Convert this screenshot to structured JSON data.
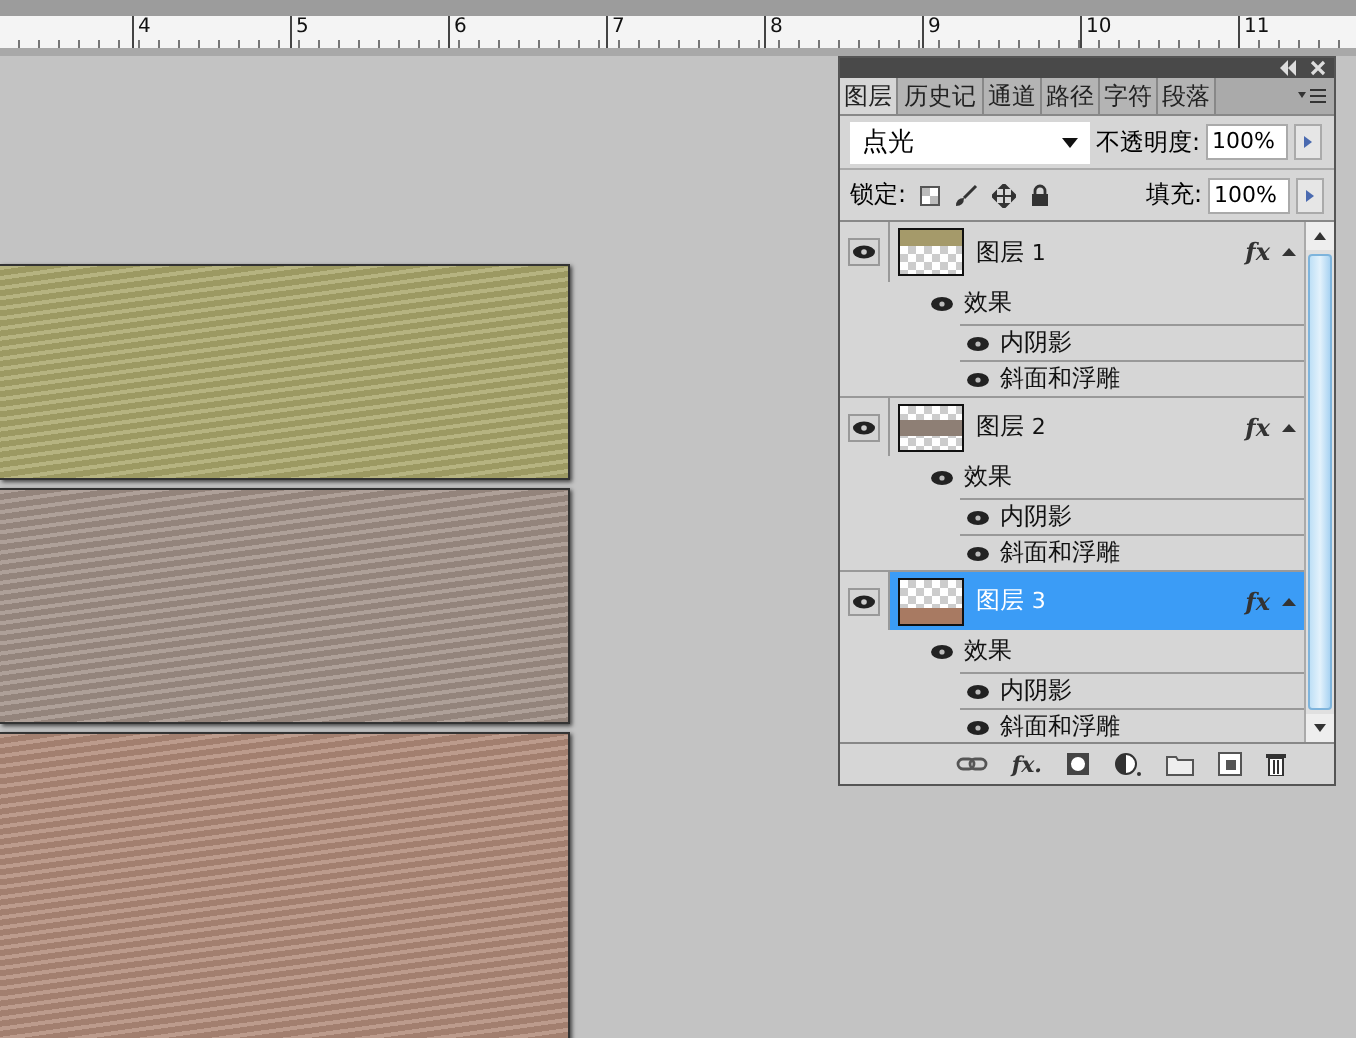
{
  "ruler": {
    "labels": [
      "4",
      "5",
      "6",
      "7",
      "8",
      "9",
      "10",
      "11"
    ]
  },
  "planks": [
    {
      "color": "#a9a66a"
    },
    {
      "color": "#a08f86"
    },
    {
      "color": "#b08a78"
    }
  ],
  "panel": {
    "tabs": [
      {
        "label": "图层",
        "selected": true
      },
      {
        "label": "历史记",
        "selected": false
      },
      {
        "label": "通道",
        "selected": false
      },
      {
        "label": "路径",
        "selected": false
      },
      {
        "label": "字符",
        "selected": false
      },
      {
        "label": "段落",
        "selected": false
      }
    ],
    "add_style_label": "fx.",
    "blend_mode": "点光",
    "opacity_label": "不透明度:",
    "opacity": "100%",
    "lock_label": "锁定:",
    "fill_label": "填充:",
    "fill": "100%",
    "layers": [
      {
        "name": "图层",
        "number": "1",
        "selected": false,
        "visible": true,
        "kind": "top",
        "fx_label": "fx",
        "color": "#a59a6a",
        "effects_label": "效果",
        "effects": [
          "内阴影",
          "斜面和浮雕"
        ]
      },
      {
        "name": "图层",
        "number": "2",
        "selected": false,
        "visible": true,
        "kind": "middle",
        "fx_label": "fx",
        "color": "#8e7f75",
        "effects_label": "效果",
        "effects": [
          "内阴影",
          "斜面和浮雕"
        ]
      },
      {
        "name": "图层",
        "number": "3",
        "selected": true,
        "visible": true,
        "kind": "bottom",
        "fx_label": "fx",
        "color": "#a87a62",
        "effects_label": "效果",
        "effects": [
          "内阴影",
          "斜面和浮雕"
        ]
      }
    ]
  }
}
